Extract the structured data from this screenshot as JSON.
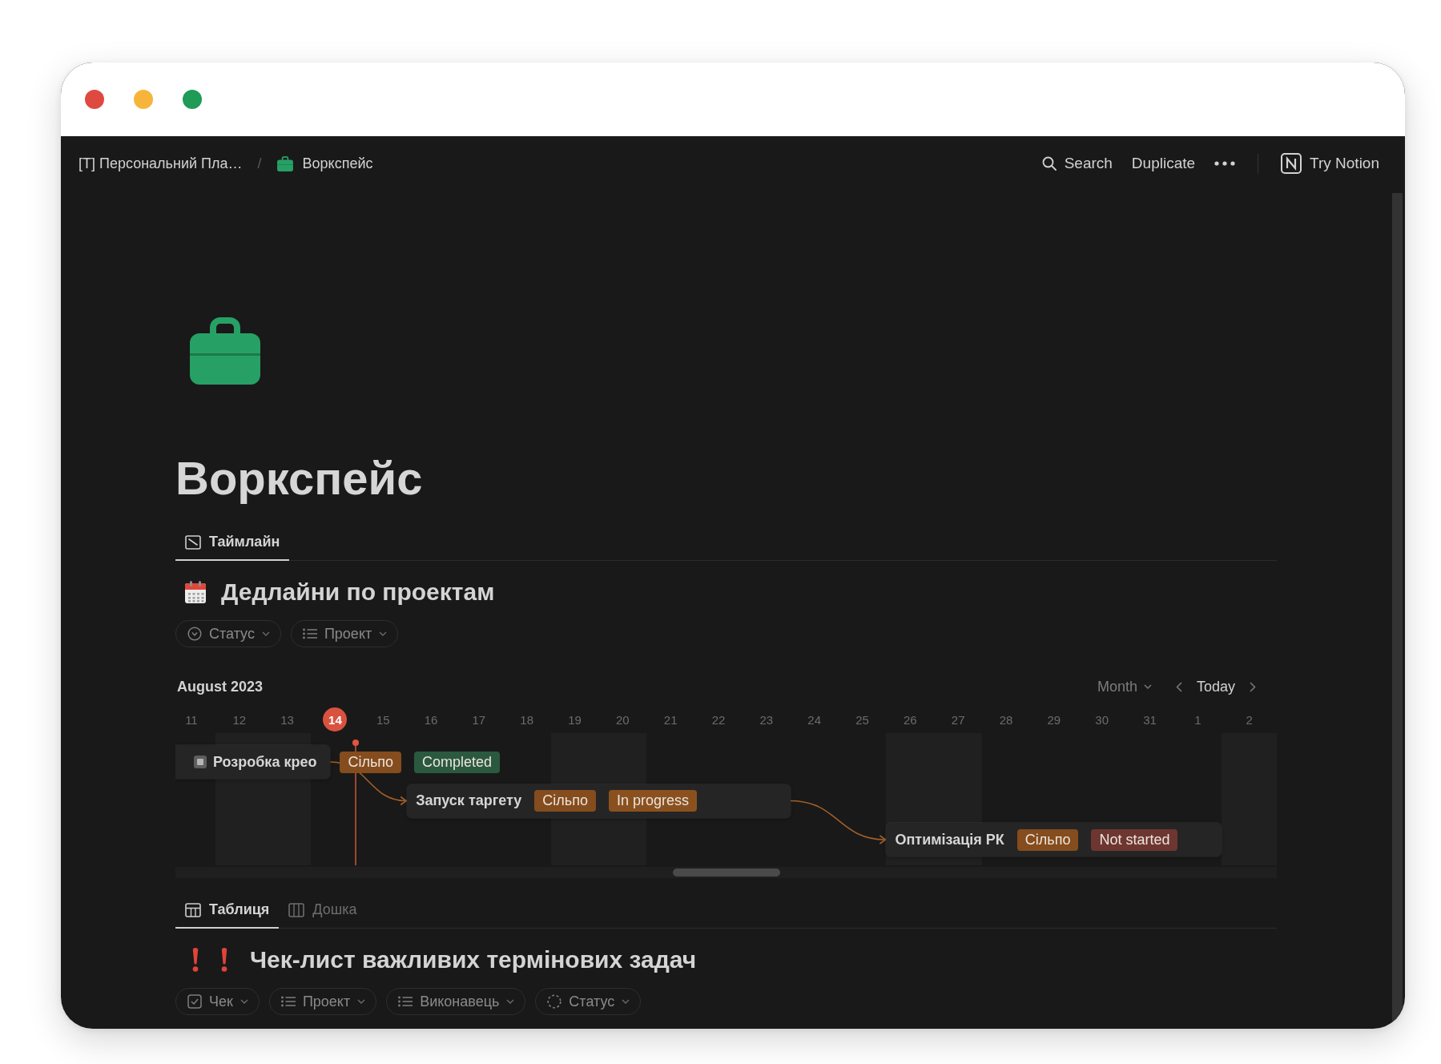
{
  "window": {
    "traffic_lights": [
      {
        "color": "#df4a40"
      },
      {
        "color": "#f6b53a"
      },
      {
        "color": "#1e9b57"
      }
    ]
  },
  "topbar": {
    "breadcrumbs": [
      {
        "kind": "page",
        "label": "[T] Персональний Пла…"
      },
      {
        "kind": "workspace",
        "label": "Воркспейс"
      }
    ],
    "separator": "/",
    "actions": [
      {
        "kind": "search",
        "label": "Search"
      },
      {
        "kind": "text",
        "label": "Duplicate"
      },
      {
        "kind": "logo",
        "label": "Try Notion"
      }
    ]
  },
  "page": {
    "title": "Воркспейс"
  },
  "blocks": [
    {
      "kind": "timeline",
      "tabs": [
        {
          "kind": "timeline",
          "label": "Таймлайн",
          "selected": true
        }
      ],
      "title": "Дедлайни по проектам",
      "filters": [
        {
          "kind": "status",
          "label": "Статус"
        },
        {
          "kind": "list",
          "label": "Проект"
        }
      ],
      "timeline": {
        "month": "August 2023",
        "scale": "Month",
        "today_button": "Today",
        "days": [
          {
            "label": "11",
            "weekend": false,
            "today": false
          },
          {
            "label": "12",
            "weekend": true,
            "today": false
          },
          {
            "label": "13",
            "weekend": true,
            "today": false
          },
          {
            "label": "14",
            "weekend": false,
            "today": true
          },
          {
            "label": "15",
            "weekend": false,
            "today": false
          },
          {
            "label": "16",
            "weekend": false,
            "today": false
          },
          {
            "label": "17",
            "weekend": false,
            "today": false
          },
          {
            "label": "18",
            "weekend": false,
            "today": false
          },
          {
            "label": "19",
            "weekend": true,
            "today": false
          },
          {
            "label": "20",
            "weekend": true,
            "today": false
          },
          {
            "label": "21",
            "weekend": false,
            "today": false
          },
          {
            "label": "22",
            "weekend": false,
            "today": false
          },
          {
            "label": "23",
            "weekend": false,
            "today": false
          },
          {
            "label": "24",
            "weekend": false,
            "today": false
          },
          {
            "label": "25",
            "weekend": false,
            "today": false
          },
          {
            "label": "26",
            "weekend": true,
            "today": false
          },
          {
            "label": "27",
            "weekend": true,
            "today": false
          },
          {
            "label": "28",
            "weekend": false,
            "today": false
          },
          {
            "label": "29",
            "weekend": false,
            "today": false
          },
          {
            "label": "30",
            "weekend": false,
            "today": false
          },
          {
            "label": "31",
            "weekend": false,
            "today": false
          },
          {
            "label": "1",
            "weekend": false,
            "today": false
          },
          {
            "label": "2",
            "weekend": true,
            "today": false
          }
        ],
        "items": [
          {
            "kind": "compact",
            "title": "Розробка крео",
            "depends_on_previous": false,
            "tags": [
              {
                "label": "Сільпо",
                "color": "#854c1d"
              },
              {
                "label": "Completed",
                "color": "#2b593f"
              }
            ]
          },
          {
            "kind": "full",
            "title": "Запуск таргету",
            "depends_on_previous": true,
            "tags": [
              {
                "label": "Сільпо",
                "color": "#854c1d"
              },
              {
                "label": "In progress",
                "color": "#8a511f"
              }
            ]
          },
          {
            "kind": "full",
            "title": "Оптимізація РК",
            "depends_on_previous": true,
            "tags": [
              {
                "label": "Сільпо",
                "color": "#854c1d"
              },
              {
                "label": "Not started",
                "color": "#6e3630"
              }
            ]
          }
        ]
      }
    },
    {
      "kind": "table",
      "tabs": [
        {
          "kind": "table",
          "label": "Таблиця",
          "selected": true
        },
        {
          "kind": "board",
          "label": "Дошка",
          "selected": false
        }
      ],
      "title": "Чек-лист важливих термінових задач",
      "filters": [
        {
          "kind": "checkbox",
          "label": "Чек"
        },
        {
          "kind": "list",
          "label": "Проект"
        },
        {
          "kind": "list",
          "label": "Виконавець"
        },
        {
          "kind": "loader",
          "label": "Статус"
        }
      ]
    }
  ]
}
